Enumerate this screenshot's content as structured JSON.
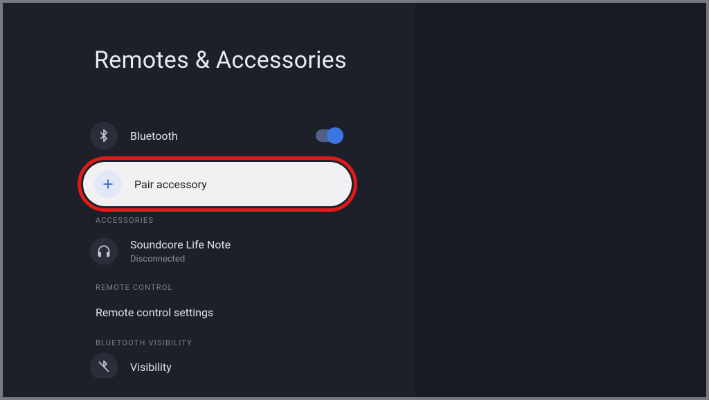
{
  "page": {
    "title": "Remotes & Accessories"
  },
  "items": {
    "bluetooth": {
      "label": "Bluetooth",
      "enabled": true
    },
    "pair": {
      "label": "Pair accessory"
    }
  },
  "sections": {
    "accessories": {
      "header": "ACCESSORIES",
      "device": {
        "name": "Soundcore Life Note",
        "status": "Disconnected"
      }
    },
    "remote": {
      "header": "REMOTE CONTROL",
      "item": {
        "label": "Remote control settings"
      }
    },
    "visibility": {
      "header": "BLUETOOTH VISIBILITY",
      "item": {
        "label": "Visibility"
      }
    }
  }
}
